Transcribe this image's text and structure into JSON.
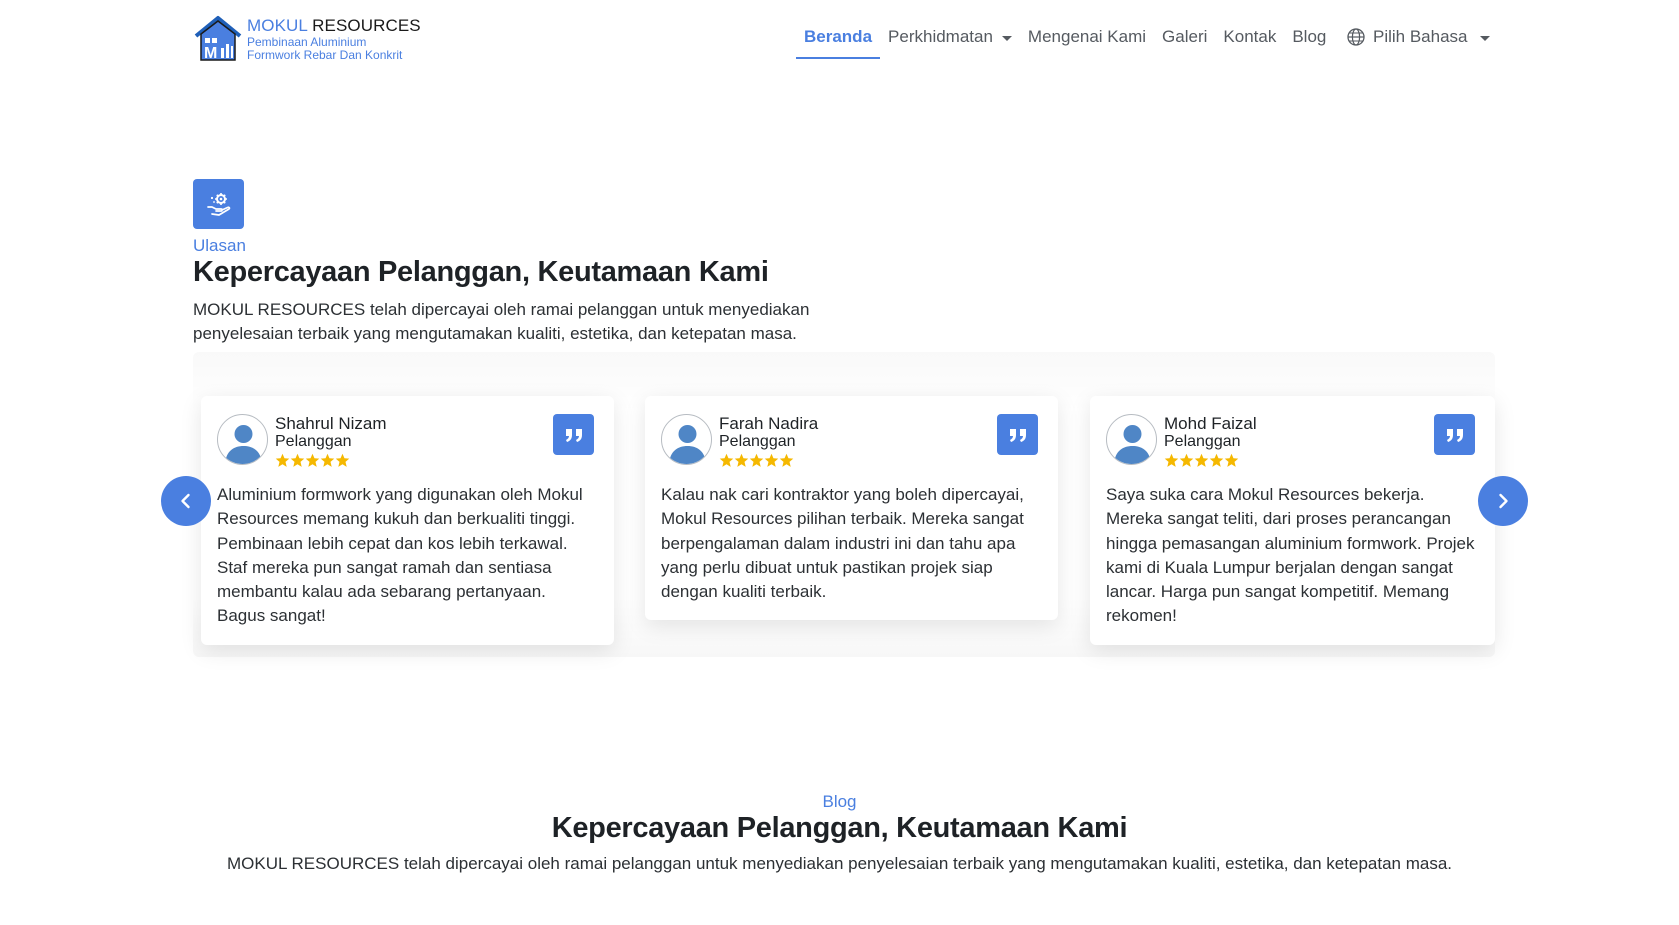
{
  "brand": {
    "name_part1": "MOKUL",
    "name_part2": "RESOURCES",
    "tagline_line1": "Pembinaan Aluminium",
    "tagline_line2": "Formwork Rebar Dan Konkrit",
    "logo_icon": "house-logo-icon"
  },
  "nav": {
    "items": [
      {
        "label": "Beranda",
        "active": true
      },
      {
        "label": "Perkhidmatan",
        "dropdown": true
      },
      {
        "label": "Mengenai Kami"
      },
      {
        "label": "Galeri"
      },
      {
        "label": "Kontak"
      },
      {
        "label": "Blog"
      }
    ],
    "language": {
      "label": "Pilih Bahasa",
      "icon": "globe-icon"
    }
  },
  "reviews": {
    "icon": "hand-gear-icon",
    "kicker": "Ulasan",
    "title": "Kepercayaan Pelanggan, Keutamaan Kami",
    "description": "MOKUL RESOURCES telah dipercayai oleh ramai pelanggan untuk menyediakan penyelesaian terbaik yang mengutamakan kualiti, estetika, dan ketepatan masa.",
    "cards": [
      {
        "name": "Shahrul Nizam",
        "role": "Pelanggan",
        "rating": 5,
        "text": "Aluminium formwork yang digunakan oleh Mokul Resources memang kukuh dan berkualiti tinggi. Pembinaan lebih cepat dan kos lebih terkawal. Staf mereka pun sangat ramah dan sentiasa membantu kalau ada sebarang pertanyaan. Bagus sangat!"
      },
      {
        "name": "Farah Nadira",
        "role": "Pelanggan",
        "rating": 5,
        "text": "Kalau nak cari kontraktor yang boleh dipercayai, Mokul Resources pilihan terbaik. Mereka sangat berpengalaman dalam industri ini dan tahu apa yang perlu dibuat untuk pastikan projek siap dengan kualiti terbaik."
      },
      {
        "name": "Mohd Faizal",
        "role": "Pelanggan",
        "rating": 5,
        "text": "Saya suka cara Mokul Resources bekerja. Mereka sangat teliti, dari proses perancangan hingga pemasangan aluminium formwork. Projek kami di Kuala Lumpur berjalan dengan sangat lancar. Harga pun sangat kompetitif. Memang rekomen!"
      }
    ]
  },
  "blog": {
    "kicker": "Blog",
    "title": "Kepercayaan Pelanggan, Keutamaan Kami",
    "description": "MOKUL RESOURCES telah dipercayai oleh ramai pelanggan untuk menyediakan penyelesaian terbaik yang mengutamakan kualiti, estetika, dan ketepatan masa."
  },
  "colors": {
    "accent": "#4a7fe0",
    "star": "#f5b800",
    "text": "#212529"
  }
}
